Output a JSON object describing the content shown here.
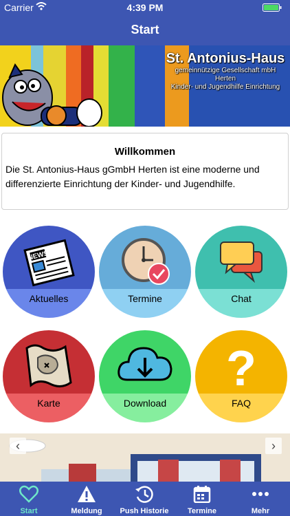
{
  "status": {
    "carrier": "Carrier",
    "time": "4:39 PM"
  },
  "nav": {
    "title": "Start"
  },
  "banner": {
    "title": "St. Antonius-Haus",
    "line1": "gemeinnützige Gesellschaft mbH Herten",
    "line2": "Kinder- und Jugendhilfe Einrichtung"
  },
  "welcome": {
    "title": "Willkommen",
    "text": "Die St. Antonius-Haus gGmbH Herten ist eine moderne und differenzierte Einrichtung der Kinder- und Jugendhilfe."
  },
  "tiles": [
    {
      "label": "Aktuelles",
      "icon": "newspaper-icon",
      "color_top": "#3f56c3",
      "color_bottom": "#6a86ea"
    },
    {
      "label": "Termine",
      "icon": "clock-icon",
      "color_top": "#66acd9",
      "color_bottom": "#8fd0f2"
    },
    {
      "label": "Chat",
      "icon": "chat-icon",
      "color_top": "#3fbfae",
      "color_bottom": "#7be0d4"
    },
    {
      "label": "Karte",
      "icon": "map-icon",
      "color_top": "#c52f34",
      "color_bottom": "#ec5f63"
    },
    {
      "label": "Download",
      "icon": "download-icon",
      "color_top": "#3fd567",
      "color_bottom": "#86ee9e"
    },
    {
      "label": "FAQ",
      "icon": "question-icon",
      "color_top": "#f4b400",
      "color_bottom": "#ffd34d"
    }
  ],
  "tabs": [
    {
      "label": "Start",
      "icon": "heart-icon",
      "active": true
    },
    {
      "label": "Meldung",
      "icon": "warning-icon"
    },
    {
      "label": "Push Historie",
      "icon": "history-icon"
    },
    {
      "label": "Termine",
      "icon": "calendar-icon"
    },
    {
      "label": "Mehr",
      "icon": "more-icon"
    }
  ],
  "colors": {
    "bar": "#3d56b2",
    "active_tab": "#6fe8c8"
  }
}
